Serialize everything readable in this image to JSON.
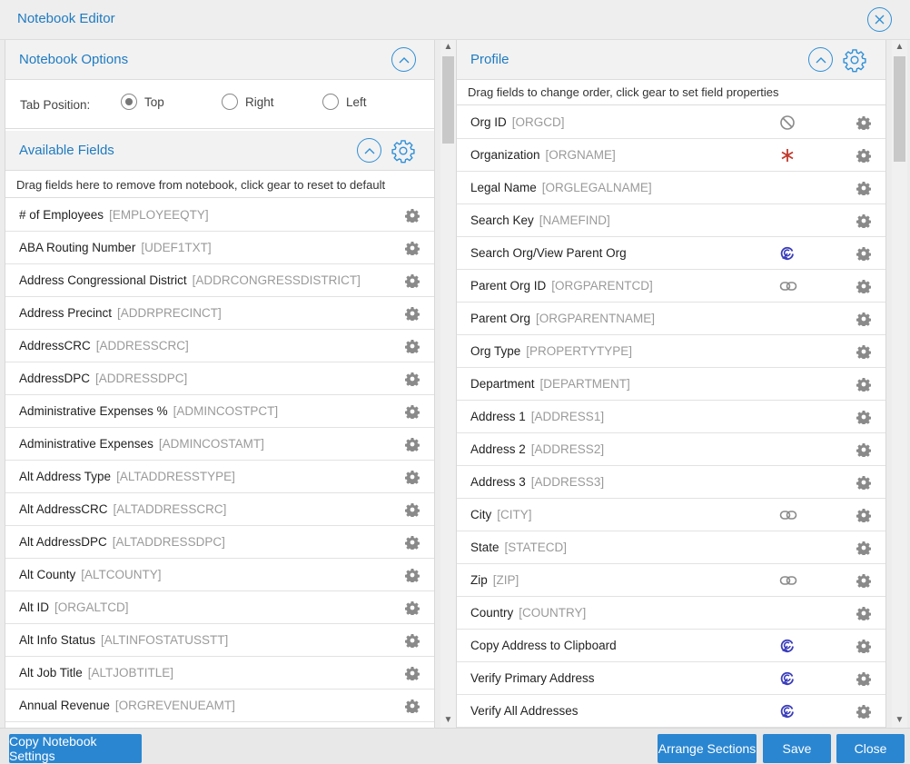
{
  "window": {
    "title": "Notebook Editor"
  },
  "left": {
    "options": {
      "title": "Notebook Options",
      "tab_position_label": "Tab Position:",
      "radios": [
        {
          "label": "Top",
          "checked": true
        },
        {
          "label": "Right",
          "checked": false
        },
        {
          "label": "Left",
          "checked": false
        }
      ]
    },
    "available": {
      "title": "Available Fields",
      "hint": "Drag fields here to remove from notebook, click gear to reset to default",
      "fields": [
        {
          "name": "# of Employees",
          "code": "[EMPLOYEEQTY]"
        },
        {
          "name": "ABA Routing Number",
          "code": "[UDEF1TXT]"
        },
        {
          "name": "Address Congressional District",
          "code": "[ADDRCONGRESSDISTRICT]"
        },
        {
          "name": "Address Precinct",
          "code": "[ADDRPRECINCT]"
        },
        {
          "name": "AddressCRC",
          "code": "[ADDRESSCRC]"
        },
        {
          "name": "AddressDPC",
          "code": "[ADDRESSDPC]"
        },
        {
          "name": "Administrative Expenses %",
          "code": "[ADMINCOSTPCT]"
        },
        {
          "name": "Administrative Expenses",
          "code": "[ADMINCOSTAMT]"
        },
        {
          "name": "Alt Address Type",
          "code": "[ALTADDRESSTYPE]"
        },
        {
          "name": "Alt AddressCRC",
          "code": "[ALTADDRESSCRC]"
        },
        {
          "name": "Alt AddressDPC",
          "code": "[ALTADDRESSDPC]"
        },
        {
          "name": "Alt County",
          "code": "[ALTCOUNTY]"
        },
        {
          "name": "Alt ID",
          "code": "[ORGALTCD]"
        },
        {
          "name": "Alt Info Status",
          "code": "[ALTINFOSTATUSSTT]"
        },
        {
          "name": "Alt Job Title",
          "code": "[ALTJOBTITLE]"
        },
        {
          "name": "Annual Revenue",
          "code": "[ORGREVENUEAMT]"
        }
      ]
    }
  },
  "right": {
    "title": "Profile",
    "hint": "Drag fields to change order, click gear to set field properties",
    "fields": [
      {
        "name": "Org ID",
        "code": "[ORGCD]",
        "icon": "disabled-icon"
      },
      {
        "name": "Organization",
        "code": "[ORGNAME]",
        "icon": "required-icon"
      },
      {
        "name": "Legal Name",
        "code": "[ORGLEGALNAME]",
        "icon": ""
      },
      {
        "name": "Search Key",
        "code": "[NAMEFIND]",
        "icon": ""
      },
      {
        "name": "Search Org/View Parent Org",
        "code": "",
        "icon": "action-icon"
      },
      {
        "name": "Parent Org ID",
        "code": "[ORGPARENTCD]",
        "icon": "link-icon"
      },
      {
        "name": "Parent Org",
        "code": "[ORGPARENTNAME]",
        "icon": ""
      },
      {
        "name": "Org Type",
        "code": "[PROPERTYTYPE]",
        "icon": ""
      },
      {
        "name": "Department",
        "code": "[DEPARTMENT]",
        "icon": ""
      },
      {
        "name": "Address 1",
        "code": "[ADDRESS1]",
        "icon": ""
      },
      {
        "name": "Address 2",
        "code": "[ADDRESS2]",
        "icon": ""
      },
      {
        "name": "Address 3",
        "code": "[ADDRESS3]",
        "icon": ""
      },
      {
        "name": "City",
        "code": "[CITY]",
        "icon": "link-icon"
      },
      {
        "name": "State",
        "code": "[STATECD]",
        "icon": ""
      },
      {
        "name": "Zip",
        "code": "[ZIP]",
        "icon": "link-icon"
      },
      {
        "name": "Country",
        "code": "[COUNTRY]",
        "icon": ""
      },
      {
        "name": "Copy Address to Clipboard",
        "code": "",
        "icon": "action-icon"
      },
      {
        "name": "Verify Primary Address",
        "code": "",
        "icon": "action-icon"
      },
      {
        "name": "Verify All Addresses",
        "code": "",
        "icon": "action-icon"
      }
    ]
  },
  "footer": {
    "copy_settings": "Copy Notebook Settings",
    "arrange": "Arrange Sections",
    "save": "Save",
    "close": "Close"
  },
  "colors": {
    "accent": "#1f7bc1",
    "button": "#2a86d1",
    "required": "#c0392b",
    "action": "#3a3dbb",
    "icon_gray": "#8a8a8a"
  }
}
